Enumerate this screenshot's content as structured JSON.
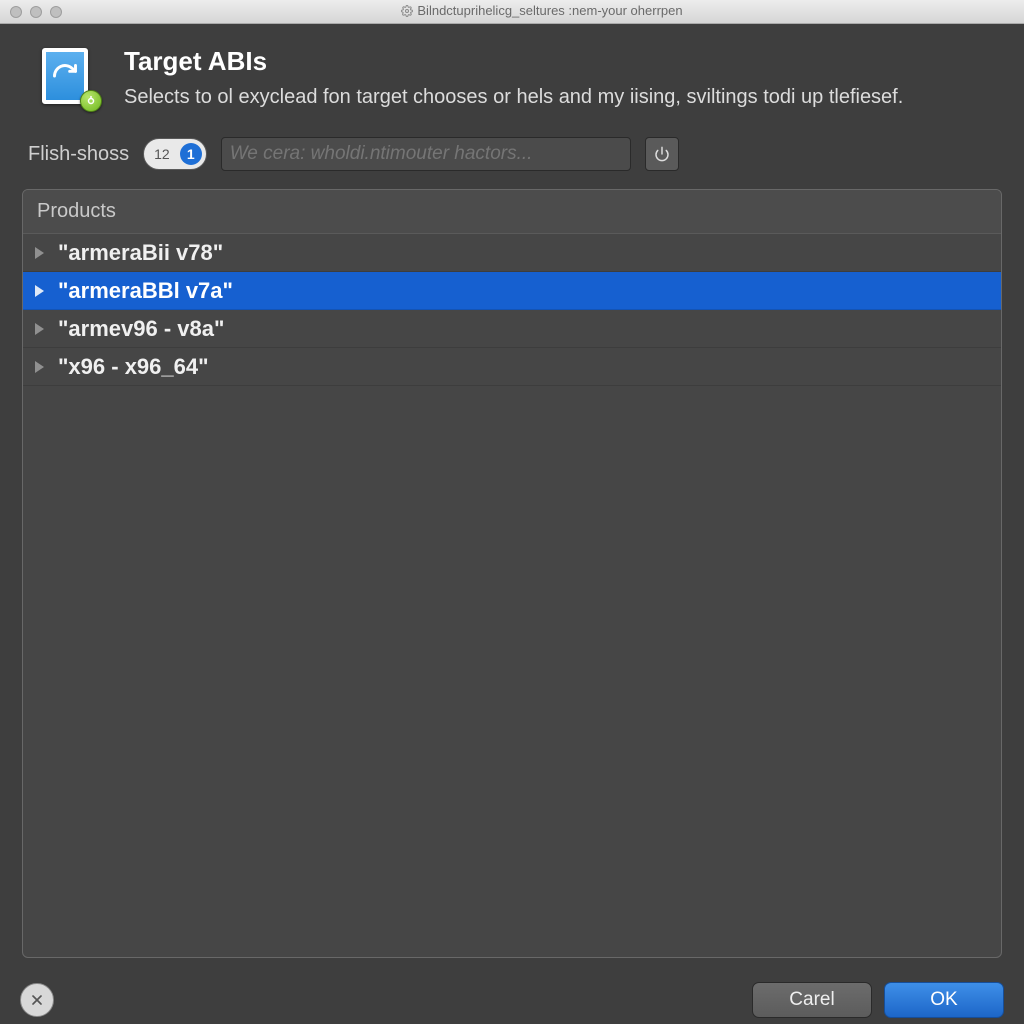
{
  "window": {
    "title": "Bilndctuprihelicg_seltures :nem-your oherrpen"
  },
  "header": {
    "title": "Target ABIs",
    "subtitle": "Selects to ol exyclead fon target chooses or hels and my iising, sviltings todi up tlefiesef."
  },
  "filter": {
    "label": "Flish-shoss",
    "seg_left": "12",
    "seg_right": "1",
    "search_placeholder": "We cera: wholdi.ntimouter hactors..."
  },
  "panel": {
    "heading": "Products",
    "rows": [
      {
        "label": "\"armeraBii v78\"",
        "selected": false
      },
      {
        "label": "\"armeraBBl v7a\"",
        "selected": true
      },
      {
        "label": "\"armev96 - v8a\"",
        "selected": false
      },
      {
        "label": "\"x96 - x96_64\"",
        "selected": false
      }
    ]
  },
  "footer": {
    "cancel": "Carel",
    "ok": "OK"
  }
}
